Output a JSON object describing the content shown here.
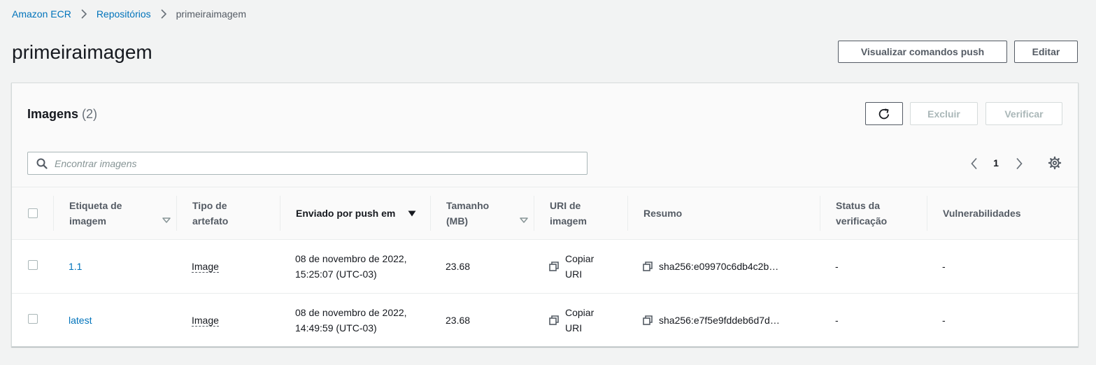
{
  "breadcrumb": {
    "items": [
      "Amazon ECR",
      "Repositórios"
    ],
    "current": "primeiraimagem"
  },
  "page": {
    "title": "primeiraimagem"
  },
  "header_buttons": {
    "push_commands": "Visualizar comandos push",
    "edit": "Editar"
  },
  "panel": {
    "title": "Imagens",
    "count": "(2)",
    "refresh_icon": "refresh-icon",
    "delete_label": "Excluir",
    "scan_label": "Verificar",
    "search_placeholder": "Encontrar imagens",
    "page": "1"
  },
  "table": {
    "headers": {
      "tag": "Etiqueta de imagem",
      "type": "Tipo de artefato",
      "pushed": "Enviado por push em",
      "size": "Tamanho (MB)",
      "uri": "URI de imagem",
      "digest": "Resumo",
      "scan_status": "Status da verificação",
      "vulns": "Vulnerabilidades"
    },
    "rows": [
      {
        "tag": "1.1",
        "type": "Image",
        "pushed": "08 de novembro de 2022, 15:25:07 (UTC-03)",
        "size": "23.68",
        "uri": "Copiar URI",
        "digest": "sha256:e09970c6db4c2b…",
        "scan_status": "-",
        "vulns": "-"
      },
      {
        "tag": "latest",
        "type": "Image",
        "pushed": "08 de novembro de 2022, 14:49:59 (UTC-03)",
        "size": "23.68",
        "uri": "Copiar URI",
        "digest": "sha256:e7f5e9fddeb6d7d…",
        "scan_status": "-",
        "vulns": "-"
      }
    ]
  },
  "colors": {
    "link": "#0073bb",
    "background": "#f2f3f3",
    "text": "#16191f",
    "muted": "#545b64"
  }
}
